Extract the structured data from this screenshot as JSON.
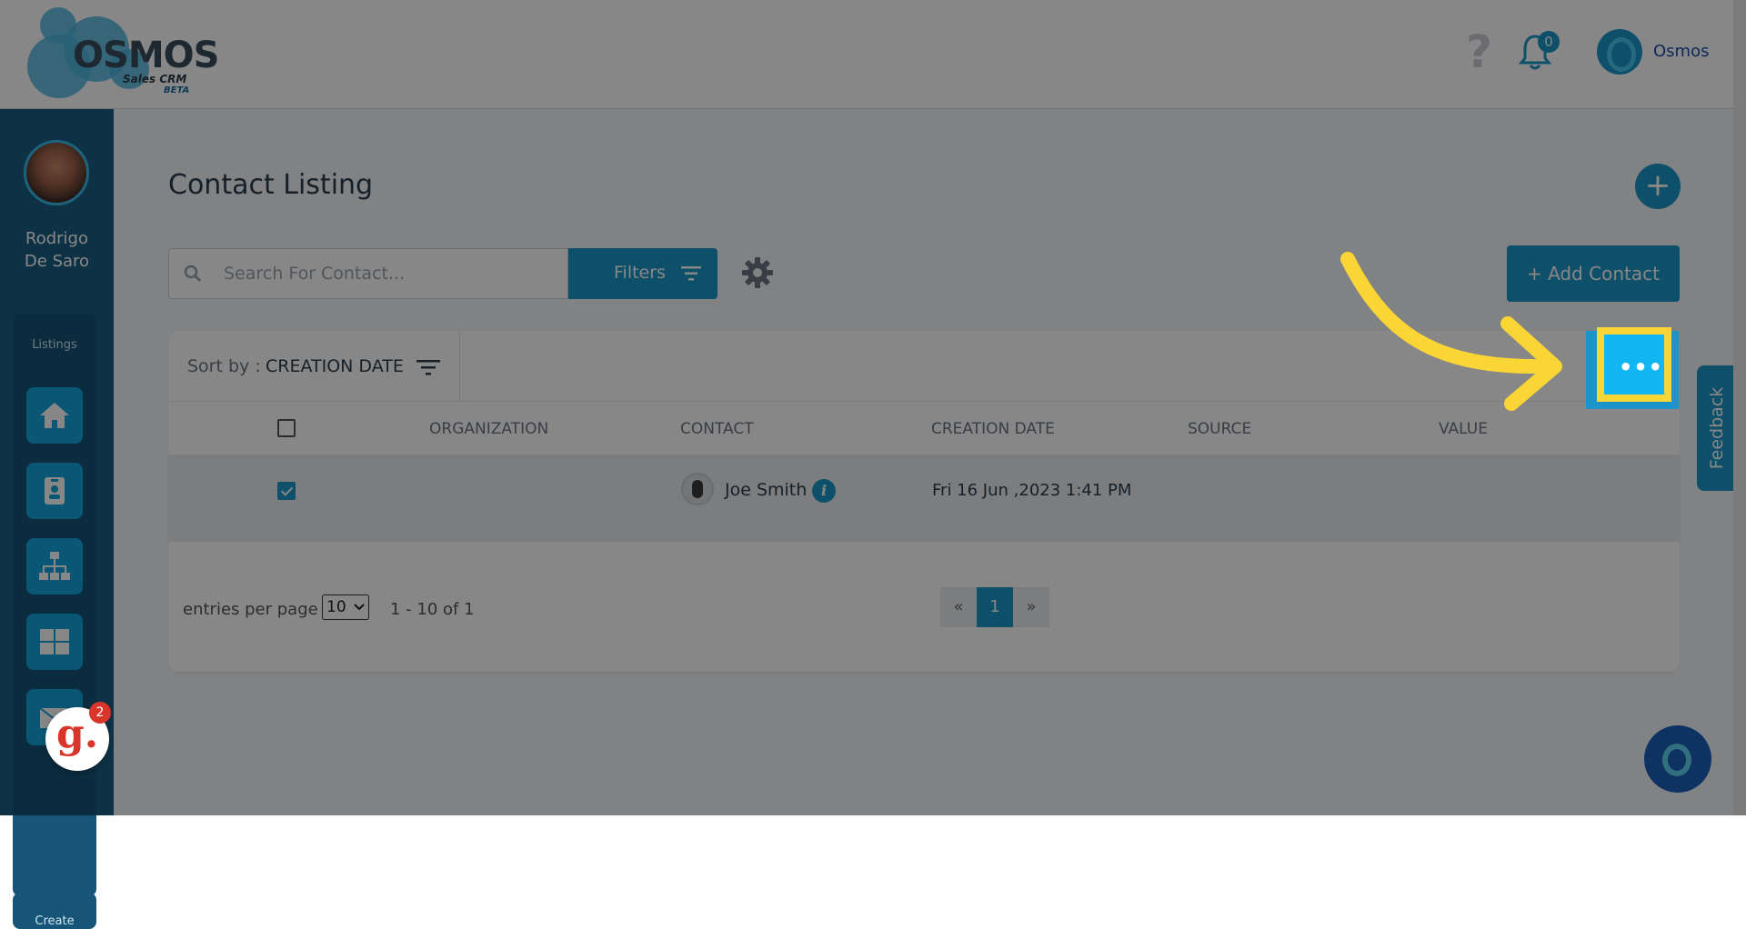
{
  "header": {
    "logo_text": "OSMOS",
    "logo_subtitle": "Sales CRM",
    "logo_badge": "BETA",
    "help_glyph": "?",
    "notification_count": "0",
    "account_name": "Osmos"
  },
  "sidebar": {
    "user_first": "Rodrigo",
    "user_last": "De Saro",
    "section_label": "Listings",
    "nav_icons": [
      "home-icon",
      "contact-card-icon",
      "org-chart-icon",
      "grid-icon",
      "mail-icon"
    ],
    "create_label": "Create",
    "g_badge_letter": "g.",
    "g_badge_count": "2"
  },
  "main": {
    "title": "Contact Listing",
    "search_placeholder": "Search For Contact...",
    "filters_label": "Filters",
    "add_contact_label": "+ Add Contact",
    "sort_label": "Sort by :",
    "sort_value": "CREATION DATE",
    "more_glyph": "•••",
    "columns": [
      "ORGANIZATION",
      "CONTACT",
      "CREATION DATE",
      "SOURCE",
      "VALUE"
    ],
    "rows": [
      {
        "organization": "",
        "contact": "Joe Smith",
        "creation_date": "Fri 16 Jun ,2023 1:41 PM",
        "source": "",
        "value": "",
        "checked": true
      }
    ],
    "entries_label": "entries per page",
    "entries_value": "10",
    "range_text": "1 - 10 of 1",
    "pager": {
      "prev": "«",
      "current": "1",
      "next": "»"
    }
  },
  "feedback_label": "Feedback",
  "colors": {
    "accent": "#1b95c9",
    "highlight": "#f9d536",
    "sidebar": "#1c5f83"
  }
}
